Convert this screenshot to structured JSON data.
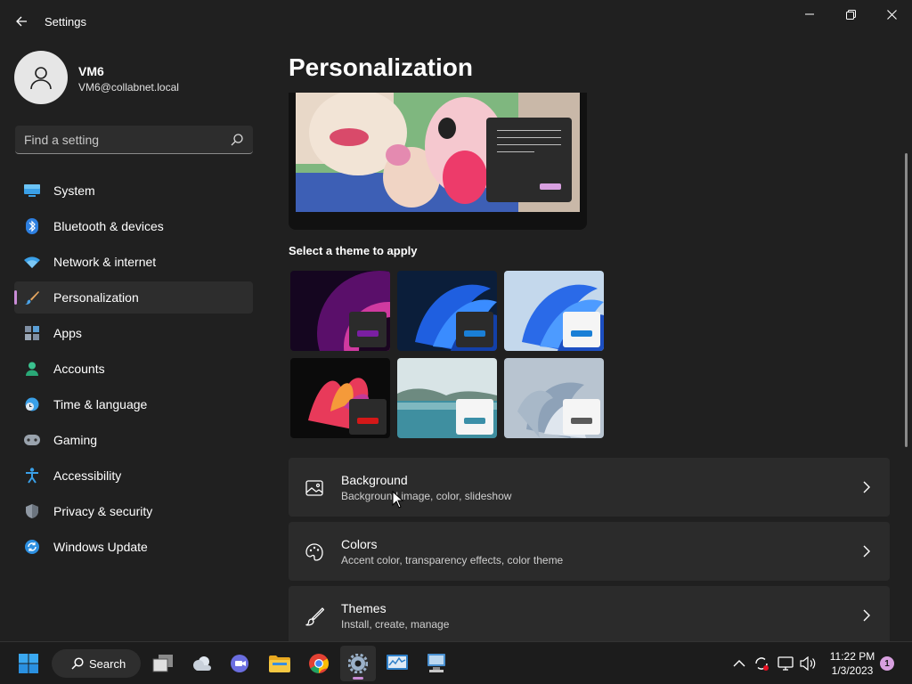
{
  "window": {
    "title": "Settings"
  },
  "user": {
    "name": "VM6",
    "email": "VM6@collabnet.local"
  },
  "search": {
    "placeholder": "Find a setting"
  },
  "sidebar": {
    "items": [
      {
        "label": "System",
        "icon": "monitor-icon"
      },
      {
        "label": "Bluetooth & devices",
        "icon": "bluetooth-icon"
      },
      {
        "label": "Network & internet",
        "icon": "wifi-icon"
      },
      {
        "label": "Personalization",
        "icon": "brush-icon",
        "active": true
      },
      {
        "label": "Apps",
        "icon": "apps-icon"
      },
      {
        "label": "Accounts",
        "icon": "person-icon"
      },
      {
        "label": "Time & language",
        "icon": "clock-globe-icon"
      },
      {
        "label": "Gaming",
        "icon": "gamepad-icon"
      },
      {
        "label": "Accessibility",
        "icon": "accessibility-icon"
      },
      {
        "label": "Privacy & security",
        "icon": "shield-icon"
      },
      {
        "label": "Windows Update",
        "icon": "update-icon"
      }
    ]
  },
  "main": {
    "title": "Personalization",
    "themes_label": "Select a theme to apply",
    "themes": [
      {
        "name": "theme-glow",
        "accent": "#7a1fa2"
      },
      {
        "name": "theme-dark-bloom",
        "accent": "#1a7fd6"
      },
      {
        "name": "theme-light-bloom",
        "accent": "#1a7fd6"
      },
      {
        "name": "theme-flower",
        "accent": "#d41818"
      },
      {
        "name": "theme-lake",
        "accent": "#3a8fa8"
      },
      {
        "name": "theme-sculpture",
        "accent": "#5a5a5a"
      }
    ],
    "cards": [
      {
        "title": "Background",
        "subtitle": "Background image, color, slideshow",
        "icon": "picture-icon"
      },
      {
        "title": "Colors",
        "subtitle": "Accent color, transparency effects, color theme",
        "icon": "palette-icon"
      },
      {
        "title": "Themes",
        "subtitle": "Install, create, manage",
        "icon": "brush-icon"
      }
    ]
  },
  "taskbar": {
    "search_label": "Search",
    "time": "11:22 PM",
    "date": "1/3/2023",
    "notifications": "1"
  },
  "colors": {
    "accent": "#c98bd6",
    "background": "#202020",
    "card": "#2b2b2b"
  }
}
